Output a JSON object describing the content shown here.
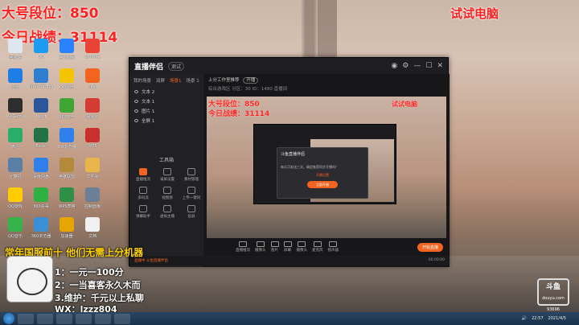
{
  "overlay": {
    "line1": "大号段位：850",
    "line2": "今日战绩：31114",
    "right": "试试电脑",
    "bottom_title": "常年国服前十 他们无需上分机器",
    "bottom1": "1：一元一100分",
    "bottom2": "2：一当喜客永久木而",
    "bottom3": "3.维护：千元以上私聊",
    "wx": "WX：lzzz804"
  },
  "desktop_icons": [
    {
      "label": "回收站",
      "color": "#dfe7ee"
    },
    {
      "label": "QQ",
      "color": "#1d9bf0"
    },
    {
      "label": "腾讯视频",
      "color": "#2b82ff"
    },
    {
      "label": "Chrome",
      "color": "#ea4335"
    },
    {
      "label": "迅雷",
      "color": "#1f7de6"
    },
    {
      "label": "Internet Explorer",
      "color": "#2f7fd1"
    },
    {
      "label": "QQ音乐",
      "color": "#f5c400"
    },
    {
      "label": "斗鱼",
      "color": "#f2641f"
    },
    {
      "label": "WeGame",
      "color": "#2e2e2e"
    },
    {
      "label": "Word",
      "color": "#2b579a"
    },
    {
      "label": "360安全",
      "color": "#3fa535"
    },
    {
      "label": "网易云",
      "color": "#d43c33"
    },
    {
      "label": "微信",
      "color": "#2aae67"
    },
    {
      "label": "Excel",
      "color": "#217346"
    },
    {
      "label": "QQ浏览器",
      "color": "#2f80ed"
    },
    {
      "label": "WPS",
      "color": "#c9302c"
    },
    {
      "label": "计算机",
      "color": "#5a7fa6"
    },
    {
      "label": "百度网盘",
      "color": "#2f80ed"
    },
    {
      "label": "英雄联盟",
      "color": "#b38a3a"
    },
    {
      "label": "文件夹",
      "color": "#e8b64a"
    },
    {
      "label": "QQ游戏",
      "color": "#ffcc00"
    },
    {
      "label": "360杀毒",
      "color": "#2eb140"
    },
    {
      "label": "WPS表格",
      "color": "#2f8f46"
    },
    {
      "label": "控制面板",
      "color": "#6b7f96"
    },
    {
      "label": "QQ音乐",
      "color": "#34b34a"
    },
    {
      "label": "360浏览器",
      "color": "#3a8fd6"
    },
    {
      "label": "加速器",
      "color": "#e6a400"
    },
    {
      "label": "文档",
      "color": "#f0f0f0"
    }
  ],
  "app": {
    "name": "直播伴侣",
    "badge": "测试",
    "tabs": [
      "我的场景",
      "双屏",
      "场景1",
      "场景 1"
    ],
    "scenes": [
      "文本 2",
      "文本 1",
      "图片 1",
      "全屏 1"
    ],
    "tools_title": "工具箱",
    "tools": [
      {
        "label": "直播推流",
        "hot": true
      },
      {
        "label": "录屏设置",
        "hot": false
      },
      {
        "label": "素材管理",
        "hot": false
      },
      {
        "label": "多码流",
        "hot": false
      },
      {
        "label": "视频源",
        "hot": false
      },
      {
        "label": "上传一键同",
        "hot": false
      },
      {
        "label": "弹幕助手",
        "hot": false
      },
      {
        "label": "虚拟主播",
        "hot": false
      },
      {
        "label": "投屏",
        "hot": false
      }
    ],
    "main_title": "上分工作室推荐",
    "main_badge": "开播",
    "main_sub": "综合游戏区  分区：30  ID：1480  直播间",
    "dialog": {
      "title": "斗鱼直播伴侣",
      "body": "每天可发送三次，确定推荐同步开播吗？",
      "link": "开播设置",
      "button": "立即开播"
    },
    "toolbar": [
      "直播推流",
      "摄像头",
      "图片",
      "屏幕",
      "摄像头",
      "麦克风",
      "扬声器"
    ],
    "live_button": "开始直播",
    "status_left": "直播中  斗鱼直播伴侣",
    "status_right": "00:00:00"
  },
  "preview_text": {
    "line1": "大号段位：850",
    "line2": "今日战绩：31114",
    "right": "试试电脑"
  },
  "douyu": {
    "name": "斗鱼",
    "sub": "douyu.com",
    "id": "93696"
  },
  "taskbar": {
    "time": "22:57",
    "date": "2021/4/5"
  }
}
